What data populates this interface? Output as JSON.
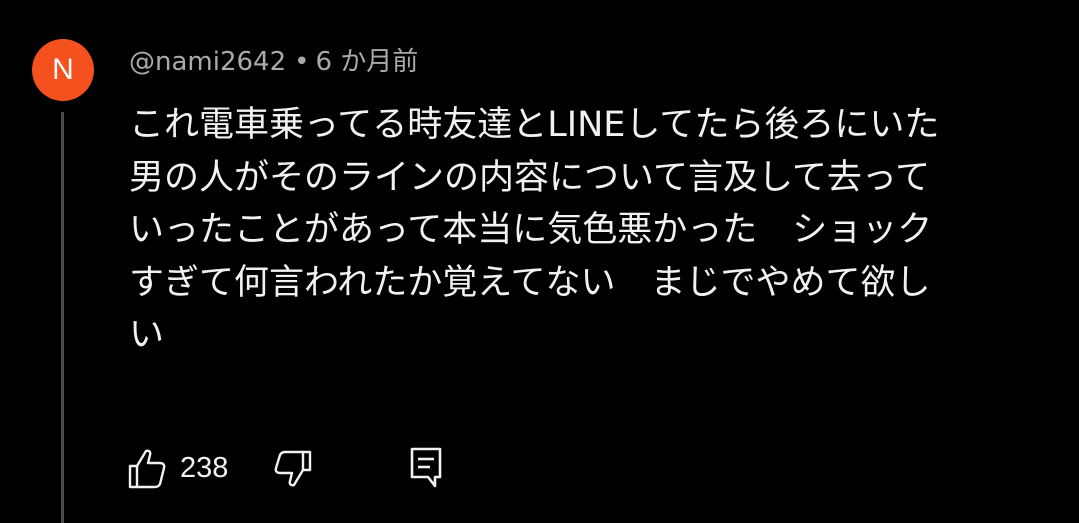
{
  "comment": {
    "avatar_letter": "N",
    "avatar_color": "#f4511e",
    "author": "@nami2642",
    "separator": "•",
    "time": "6 か月前",
    "lines": [
      "これ電車乗ってる時友達とLINEしてたら後ろにいた",
      "男の人がそのラインの内容について言及して去って",
      "いったことがあって本当に気色悪かった　ショック",
      "すぎて何言われたか覚えてない　まじでやめて欲し",
      "い"
    ],
    "like_count": "238",
    "icons": {
      "like": "thumbs-up-icon",
      "dislike": "thumbs-down-icon",
      "reply": "reply-comment-icon"
    }
  }
}
